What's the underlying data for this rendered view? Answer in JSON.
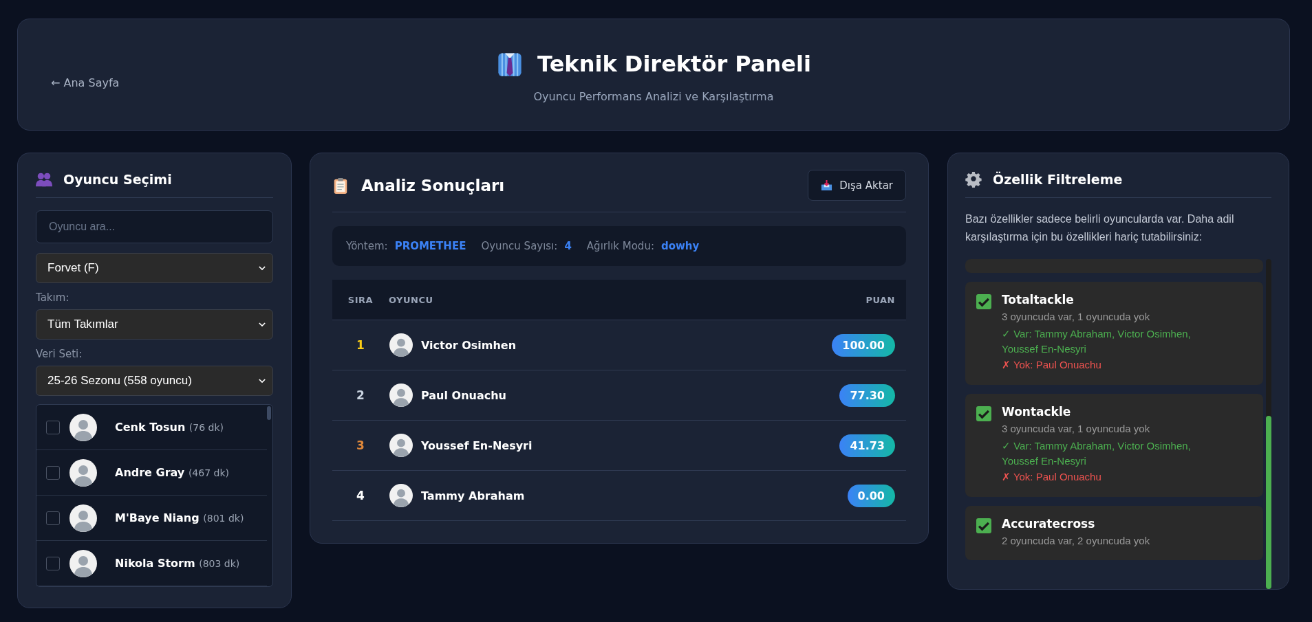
{
  "header": {
    "back_link": "← Ana Sayfa",
    "title": "Teknik Direktör Paneli",
    "subtitle": "Oyuncu Performans Analizi ve Karşılaştırma"
  },
  "player_selection": {
    "title": "Oyuncu Seçimi",
    "search": {
      "placeholder": "Oyuncu ara..."
    },
    "position_select": "Forvet (F)",
    "team_label": "Takım:",
    "team_select": "Tüm Takımlar",
    "dataset_label": "Veri Seti:",
    "dataset_select": "25-26 Sezonu (558 oyuncu)",
    "players": [
      {
        "name": "Cenk Tosun",
        "minutes": "(76 dk)",
        "checked": false
      },
      {
        "name": "Andre Gray",
        "minutes": "(467 dk)",
        "checked": false
      },
      {
        "name": "M'Baye Niang",
        "minutes": "(801 dk)",
        "checked": false
      },
      {
        "name": "Nikola Storm",
        "minutes": "(803 dk)",
        "checked": false
      }
    ]
  },
  "analysis": {
    "title": "Analiz Sonuçları",
    "export_button": "Dışa Aktar",
    "info": [
      {
        "label": "Yöntem:",
        "value": "PROMETHEE"
      },
      {
        "label": "Oyuncu Sayısı:",
        "value": "4"
      },
      {
        "label": "Ağırlık Modu:",
        "value": "dowhy"
      }
    ],
    "table": {
      "columns": [
        "SIRA",
        "OYUNCU",
        "PUAN"
      ],
      "rows": [
        {
          "rank": "1",
          "color": "#facc15",
          "player": "Victor Osimhen",
          "score": "100.00"
        },
        {
          "rank": "2",
          "color": "#cbd5e1",
          "player": "Paul Onuachu",
          "score": "77.30"
        },
        {
          "rank": "3",
          "color": "#e0883a",
          "player": "Youssef En-Nesyri",
          "score": "41.73"
        },
        {
          "rank": "4",
          "color": "#ffffff",
          "player": "Tammy Abraham",
          "score": "0.00"
        }
      ]
    }
  },
  "feature_filter": {
    "title": "Özellik Filtreleme",
    "description": "Bazı özellikler sadece belirli oyuncularda var. Daha adil karşılaştırma için bu özellikleri hariç tutabilirsiniz:",
    "features": [
      {
        "name": "Totaltackle",
        "checked": true,
        "summary": "3 oyuncuda var, 1 oyuncuda yok",
        "present": "✓ Var: Tammy Abraham, Victor Osimhen, Youssef En-Nesyri",
        "absent": "✗ Yok: Paul Onuachu"
      },
      {
        "name": "Wontackle",
        "checked": true,
        "summary": "3 oyuncuda var, 1 oyuncuda yok",
        "present": "✓ Var: Tammy Abraham, Victor Osimhen, Youssef En-Nesyri",
        "absent": "✗ Yok: Paul Onuachu"
      },
      {
        "name": "Accuratecross",
        "checked": true,
        "summary": "2 oyuncuda var, 2 oyuncuda yok"
      }
    ]
  }
}
